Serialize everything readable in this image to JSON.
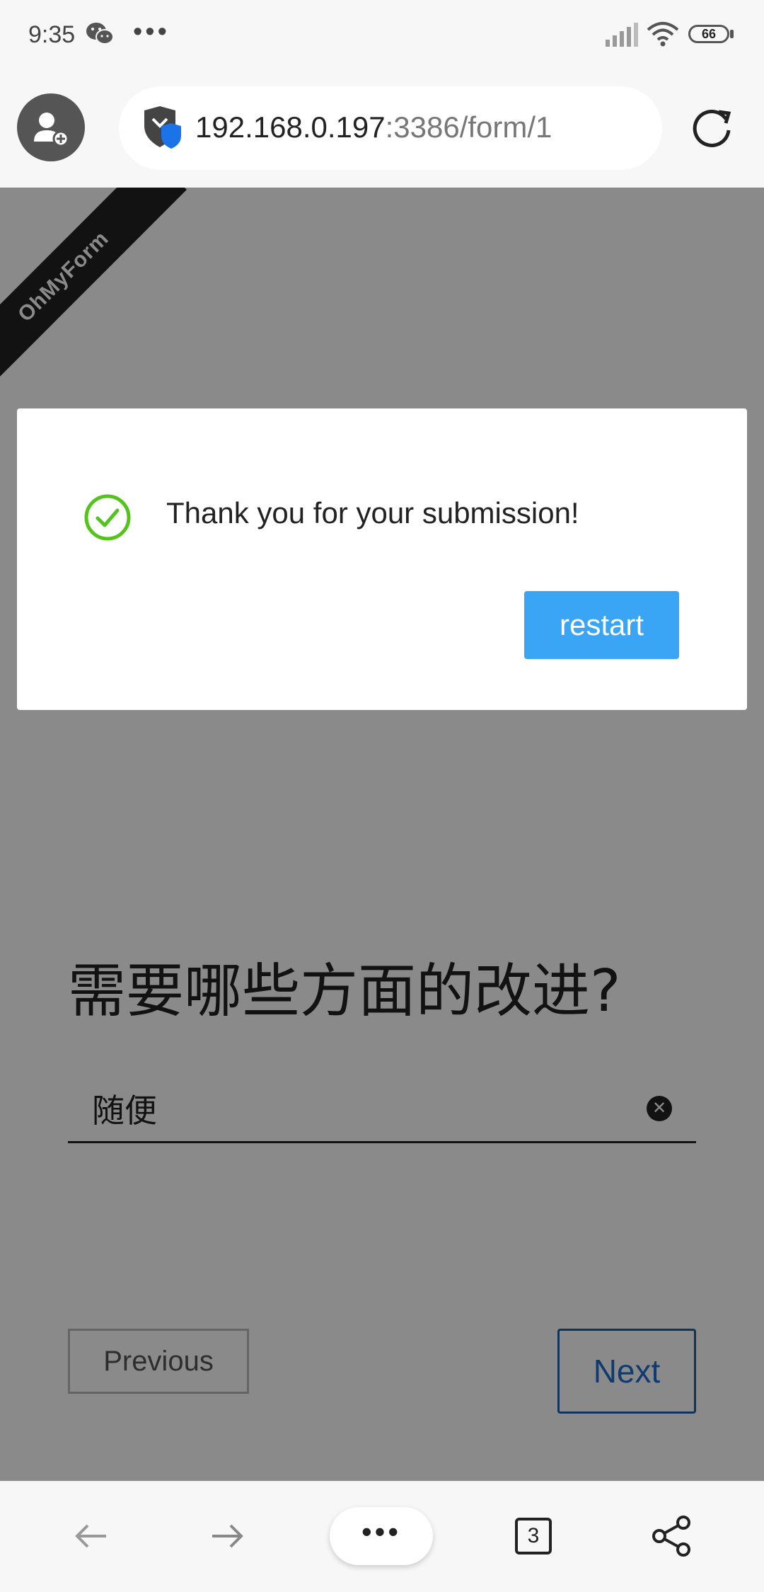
{
  "status_bar": {
    "time": "9:35",
    "overflow_dots": "•••",
    "battery_level": "66",
    "icons": [
      "wechat-icon",
      "signal-icon",
      "wifi-icon",
      "battery-icon"
    ]
  },
  "browser": {
    "url_host": "192.168.0.197",
    "url_path": ":3386/form/1",
    "icons": [
      "profile-add-icon",
      "security-shield-icon",
      "reload-icon"
    ]
  },
  "page": {
    "ribbon_text": "OhMyForm",
    "question": "需要哪些方面的改进?",
    "answer_value": "随便",
    "clear_symbol": "✕",
    "previous_label": "Previous",
    "next_label": "Next",
    "colors": {
      "next_border": "#1d5fa8",
      "next_text": "#1d6fd0"
    }
  },
  "dialog": {
    "message": "Thank you for your submission!",
    "restart_label": "restart",
    "colors": {
      "check": "#52c41a",
      "restart_bg": "#3aa4f5"
    }
  },
  "bottom_nav": {
    "menu_label": "•••",
    "tab_count": "3",
    "icons": [
      "back-arrow-icon",
      "forward-arrow-icon",
      "menu-dots-icon",
      "tabs-icon",
      "share-icon"
    ]
  }
}
